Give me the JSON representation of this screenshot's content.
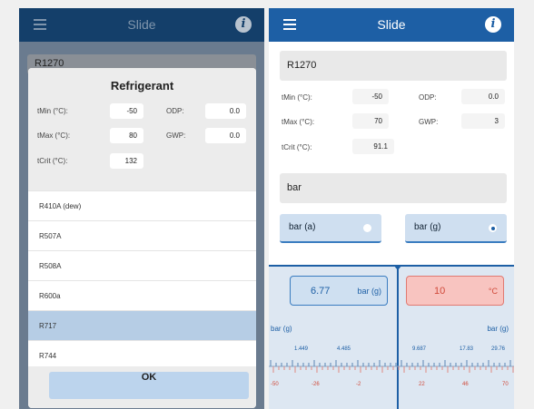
{
  "left": {
    "nav": {
      "title": "Slide"
    },
    "peek_value": "R1270",
    "modal": {
      "title": "Refrigerant",
      "tmin_label": "tMin (°C):",
      "tmin": "-50",
      "tmax_label": "tMax (°C):",
      "tmax": "80",
      "tcrit_label": "tCrit (°C):",
      "tcrit": "132",
      "odp_label": "ODP:",
      "odp": "0.0",
      "gwp_label": "GWP:",
      "gwp": "0.0",
      "items": [
        "R410A (dew)",
        "R507A",
        "R508A",
        "R600a",
        "R717",
        "R744"
      ],
      "selected": "R717",
      "ok": "OK"
    }
  },
  "right": {
    "nav": {
      "title": "Slide"
    },
    "refrigerant": "R1270",
    "tmin_label": "tMin (°C):",
    "tmin": "-50",
    "tmax_label": "tMax (°C):",
    "tmax": "70",
    "tcrit_label": "tCrit (°C):",
    "tcrit": "91.1",
    "odp_label": "ODP:",
    "odp": "0.0",
    "gwp_label": "GWP:",
    "gwp": "3",
    "unit_group": "bar",
    "unit_a": "bar (a)",
    "unit_g": "bar (g)",
    "selected_unit": "bar (g)",
    "pressure_value": "6.77",
    "pressure_unit": "bar (g)",
    "temp_value": "10",
    "temp_unit": "°C",
    "scale_left_label": "bar (g)",
    "scale_right_label": "bar (g)",
    "ticks_top": [
      "1.449",
      "4.485",
      "9.687",
      "17.83",
      "29.76"
    ],
    "ticks_bottom": [
      "-50",
      "-26",
      "-2",
      "22",
      "46",
      "70"
    ]
  },
  "colors": {
    "nav": "#1d5fa5",
    "pressure_box": "#cfe0f1",
    "temp_box": "#f8c4c0",
    "selected_row": "#b6cde5"
  }
}
